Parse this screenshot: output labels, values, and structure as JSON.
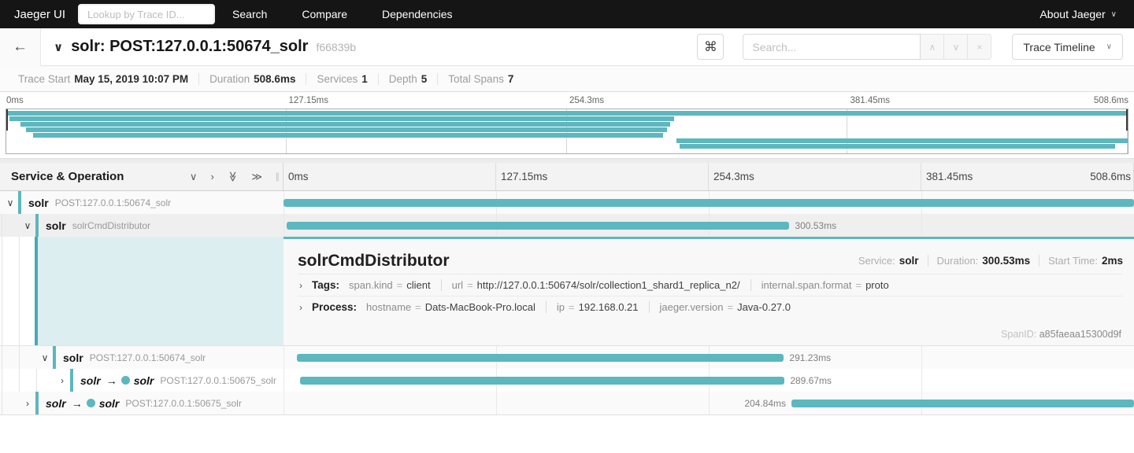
{
  "icons": {
    "back": "←",
    "chevron_down": "∨",
    "chevron_right": "›",
    "dbl_chevron": "≫",
    "cmd": "⌘",
    "caret_down": "∨",
    "prev": "∧",
    "next": "∨",
    "close": "×",
    "rpc_arrow": "→",
    "resizer": "∥"
  },
  "topnav": {
    "brand": "Jaeger UI",
    "lookup_placeholder": "Lookup by Trace ID...",
    "items": {
      "search": "Search",
      "compare": "Compare",
      "dependencies": "Dependencies"
    },
    "about": "About Jaeger"
  },
  "header": {
    "title": "solr: POST:127.0.0.1:50674_solr",
    "trace_id_short": "f66839b",
    "search_placeholder": "Search...",
    "view_selector": "Trace Timeline"
  },
  "meta": {
    "trace_start_label": "Trace Start",
    "trace_start": "May 15, 2019 10:07 PM",
    "duration_label": "Duration",
    "duration": "508.6ms",
    "services_label": "Services",
    "services": "1",
    "depth_label": "Depth",
    "depth": "5",
    "total_spans_label": "Total Spans",
    "total_spans": "7"
  },
  "timeline": {
    "duration_ms": 508.6,
    "ticks": [
      "0ms",
      "127.15ms",
      "254.3ms",
      "381.45ms",
      "508.6ms"
    ]
  },
  "minimap": {
    "bars": [
      {
        "start": 0,
        "end": 508.6
      },
      {
        "start": 1.5,
        "end": 303
      },
      {
        "start": 6.5,
        "end": 301
      },
      {
        "start": 9,
        "end": 299.5
      },
      {
        "start": 12,
        "end": 298
      },
      {
        "start": 304,
        "end": 508.6
      },
      {
        "start": 305.5,
        "end": 503
      }
    ]
  },
  "table_header": {
    "title": "Service & Operation"
  },
  "spans": {
    "rows": [
      {
        "depth": 0,
        "service": "solr",
        "operation": "POST:127.0.0.1:50674_solr",
        "bar": {
          "start": 0,
          "end": 508.6
        },
        "duration_label": ""
      },
      {
        "depth": 1,
        "service": "solr",
        "operation": "solrCmdDistributor",
        "bar": {
          "start": 2,
          "end": 302.53
        },
        "duration_label": "300.53ms"
      },
      {
        "depth": 2,
        "service": "solr",
        "operation": "POST:127.0.0.1:50674_solr",
        "bar": {
          "start": 8,
          "end": 299.23
        },
        "duration_label": "291.23ms"
      },
      {
        "depth": 3,
        "service": "solr",
        "service_to": "solr",
        "operation": "POST:127.0.0.1:50675_solr",
        "bar": {
          "start": 10,
          "end": 299.67
        },
        "duration_label": "289.67ms"
      },
      {
        "depth": 1,
        "service": "solr",
        "service_to": "solr",
        "operation": "POST:127.0.0.1:50675_solr",
        "bar": {
          "start": 303.76,
          "end": 508.6
        },
        "duration_label": "204.84ms",
        "label_side": "left"
      }
    ]
  },
  "detail": {
    "operation": "solrCmdDistributor",
    "service_label": "Service:",
    "service": "solr",
    "duration_label": "Duration:",
    "duration": "300.53ms",
    "start_time_label": "Start Time:",
    "start_time": "2ms",
    "eq": "=",
    "tags_label": "Tags:",
    "tags": [
      {
        "key": "span.kind",
        "value": "client"
      },
      {
        "key": "url",
        "value": "http://127.0.0.1:50674/solr/collection1_shard1_replica_n2/"
      },
      {
        "key": "internal.span.format",
        "value": "proto"
      }
    ],
    "process_label": "Process:",
    "process": [
      {
        "key": "hostname",
        "value": "Dats-MacBook-Pro.local"
      },
      {
        "key": "ip",
        "value": "192.168.0.21"
      },
      {
        "key": "jaeger.version",
        "value": "Java-0.27.0"
      }
    ],
    "span_id_label": "SpanID:",
    "span_id": "a85faeaa15300d9f"
  },
  "accent_color": "#5cb7bf"
}
